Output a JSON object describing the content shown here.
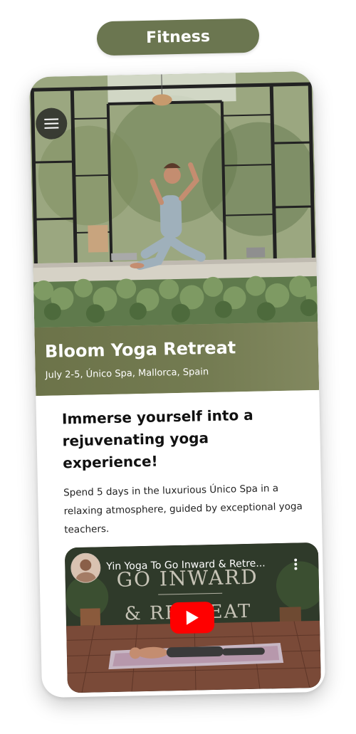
{
  "category_pill": {
    "label": "Fitness"
  },
  "hero": {
    "menu_icon": "hamburger-menu-icon"
  },
  "event": {
    "title": "Bloom Yoga Retreat",
    "subtitle": "July 2-5, Único Spa, Mallorca, Spain"
  },
  "content": {
    "headline": "Immerse yourself into a rejuvenating yoga experience!",
    "description": "Spend 5 days in the luxurious Único Spa in a relaxing atmosphere, guided by exceptional yoga teachers."
  },
  "video": {
    "title": "Yin Yoga To Go Inward & Retre...",
    "overlay_line1": "GO INWARD",
    "overlay_line2": "& RETREAT",
    "play_icon": "play-icon",
    "more_icon": "more-vertical-icon"
  },
  "colors": {
    "accent_olive": "#6b7650",
    "band_olive": "#697046",
    "youtube_red": "#ff0000"
  }
}
